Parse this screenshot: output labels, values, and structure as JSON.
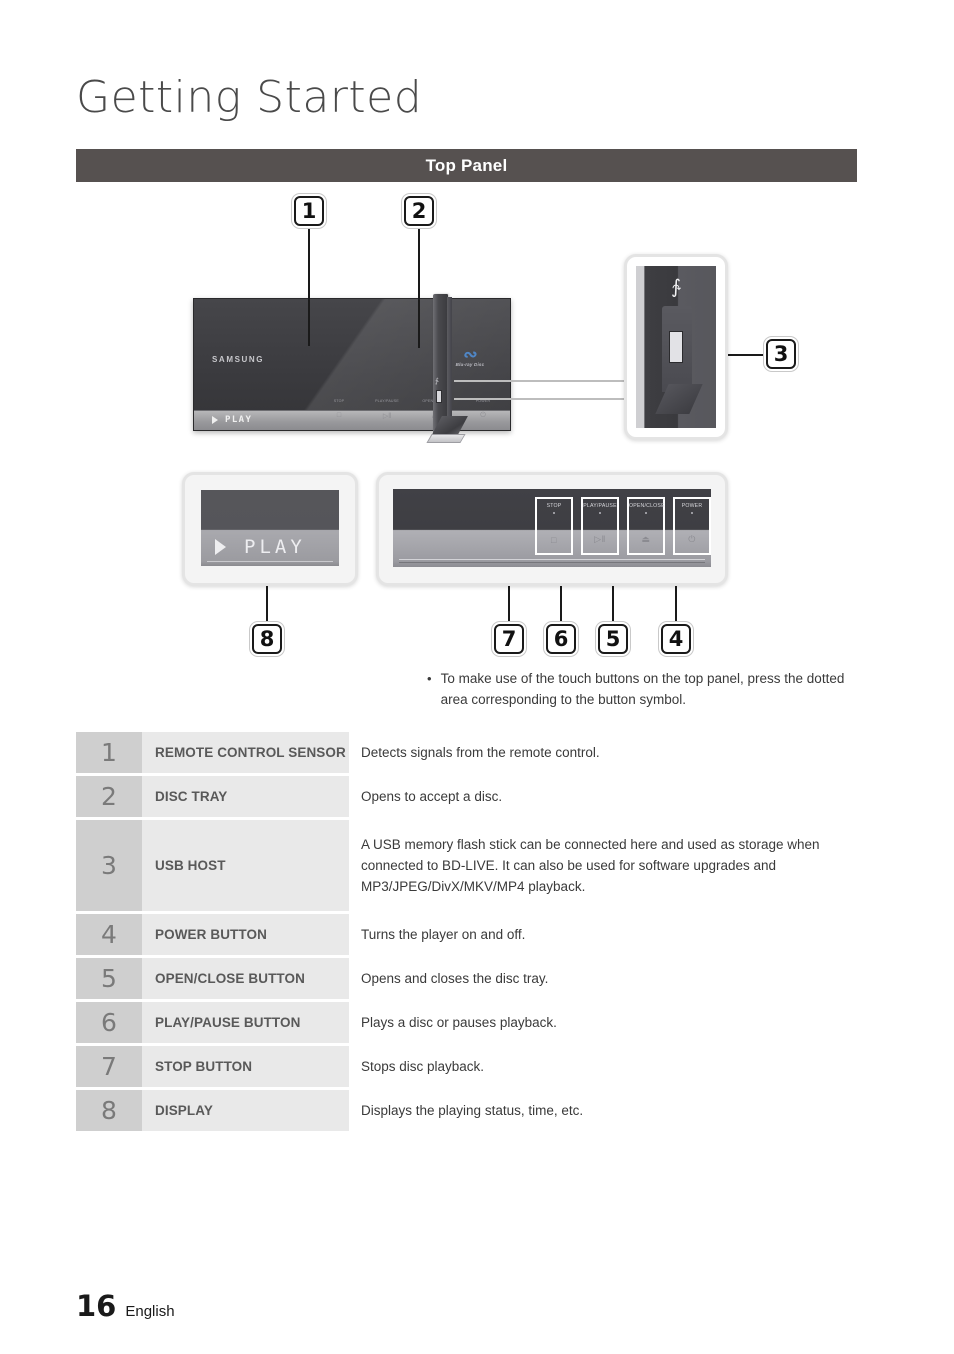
{
  "page": {
    "title": "Getting Started",
    "section_title": "Top Panel",
    "footer_number": "16",
    "footer_language": "English"
  },
  "colors": {
    "section_bar_bg": "#565150",
    "table_number_bg": "#cfcfcf",
    "table_label_bg": "#e9e9e9",
    "bluray_blue": "#4f86c6"
  },
  "illustration": {
    "brand_logo": "SAMSUNG",
    "bluray_mark": "↺",
    "bluray_text": "Blu-ray Disc",
    "front_display_text": "PLAY",
    "magnified_display_text": "PLAY",
    "usb_icon": "usb-trident-icon",
    "callouts": [
      {
        "number": "1",
        "target": "remote-control-sensor"
      },
      {
        "number": "2",
        "target": "disc-tray"
      },
      {
        "number": "3",
        "target": "usb-host"
      },
      {
        "number": "4",
        "target": "power-button"
      },
      {
        "number": "5",
        "target": "open-close-button"
      },
      {
        "number": "6",
        "target": "play-pause-button"
      },
      {
        "number": "7",
        "target": "stop-button"
      },
      {
        "number": "8",
        "target": "display"
      }
    ],
    "touch_buttons": [
      {
        "label": "STOP",
        "symbol": "□"
      },
      {
        "label": "PLAY/PAUSE",
        "symbol": "▷‖"
      },
      {
        "label": "OPEN/CLOSE",
        "symbol": "⏏"
      },
      {
        "label": "POWER",
        "symbol": "⏻"
      }
    ]
  },
  "note": {
    "bullet": "•",
    "text": "To make use of the touch buttons on the top panel, press the dotted area corresponding to the button symbol."
  },
  "spec_table": {
    "rows": [
      {
        "number": "1",
        "label": "REMOTE CONTROL SENSOR",
        "description": "Detects signals from the remote control."
      },
      {
        "number": "2",
        "label": "DISC TRAY",
        "description": "Opens to accept a disc."
      },
      {
        "number": "3",
        "label": "USB HOST",
        "description": "A USB memory flash stick can be connected here and used as storage when connected to BD-LIVE. It can also be used for software upgrades and MP3/JPEG/DivX/MKV/MP4 playback."
      },
      {
        "number": "4",
        "label": "POWER BUTTON",
        "description": "Turns the player on and off."
      },
      {
        "number": "5",
        "label": "OPEN/CLOSE BUTTON",
        "description": "Opens and closes the disc tray."
      },
      {
        "number": "6",
        "label": "PLAY/PAUSE BUTTON",
        "description": "Plays a disc or pauses playback."
      },
      {
        "number": "7",
        "label": "STOP BUTTON",
        "description": "Stops disc playback."
      },
      {
        "number": "8",
        "label": "DISPLAY",
        "description": "Displays the playing status, time, etc."
      }
    ]
  }
}
